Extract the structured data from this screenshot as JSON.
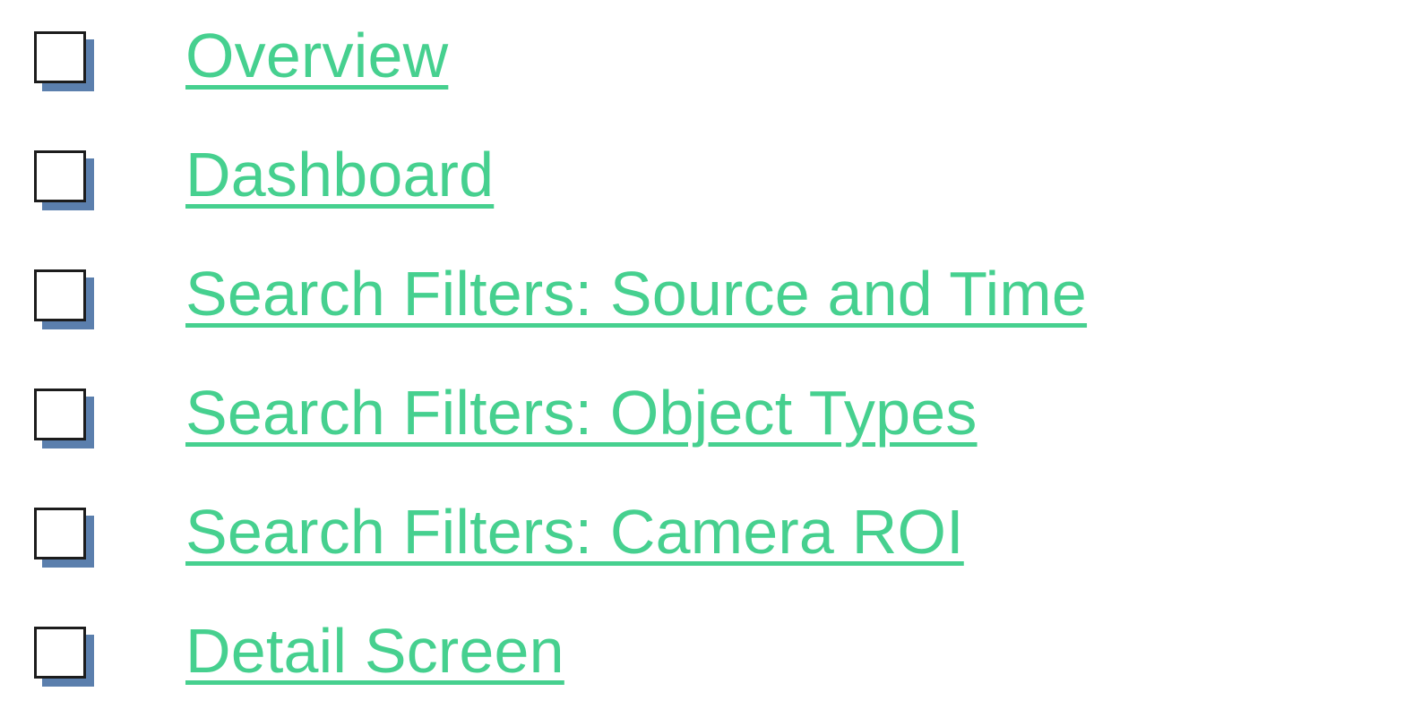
{
  "link_color": "#46d08f",
  "checkbox_shadow_color": "#5b7fad",
  "bullet_icon": "checkbox-icon",
  "items": [
    {
      "label": "Overview"
    },
    {
      "label": "Dashboard"
    },
    {
      "label": "Search Filters: Source and Time"
    },
    {
      "label": "Search Filters: Object Types"
    },
    {
      "label": "Search Filters: Camera ROI"
    },
    {
      "label": "Detail Screen"
    }
  ]
}
